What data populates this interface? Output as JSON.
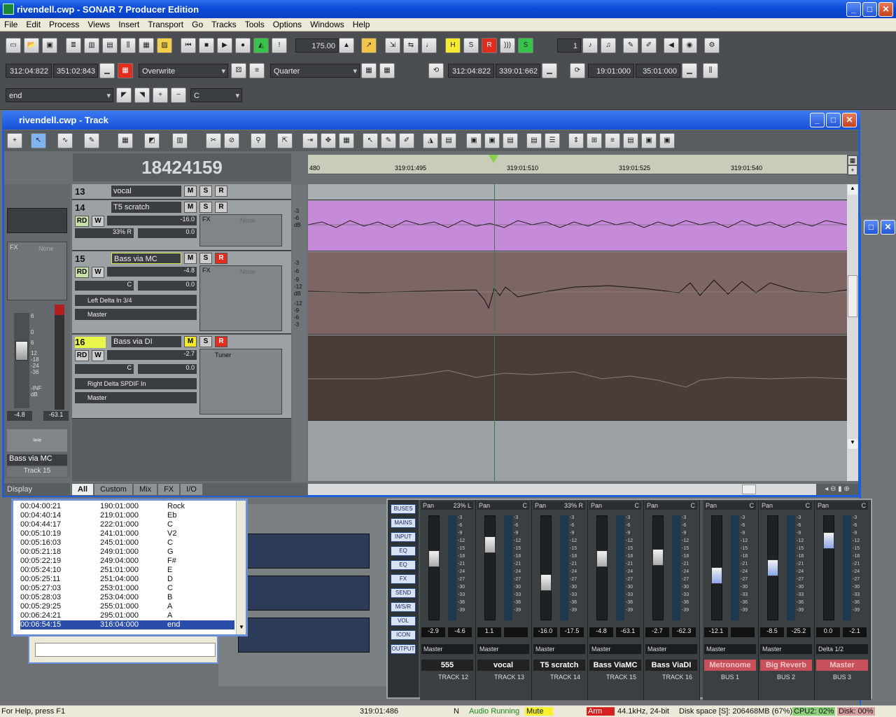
{
  "window": {
    "title": "rivendell.cwp - SONAR 7 Producer Edition"
  },
  "menu": [
    "File",
    "Edit",
    "Process",
    "Views",
    "Insert",
    "Transport",
    "Go",
    "Tracks",
    "Tools",
    "Options",
    "Windows",
    "Help"
  ],
  "toolbar": {
    "tempo": "175.00",
    "now_start": "312:04:822",
    "now_end": "351:02:843",
    "edit_mode": "Overwrite",
    "snap": "Quarter",
    "loop_start": "312:04:822",
    "loop_end": "339:01:662",
    "punch_start": "19:01:000",
    "punch_end": "35:01:000",
    "meter": "1",
    "marker_combo": "end",
    "key_combo": "C",
    "h": "H",
    "s": "S",
    "r": "R"
  },
  "trackview": {
    "title": "rivendell.cwp - Track",
    "counter": "18424159",
    "ruler": [
      "480",
      "319:01:495",
      "319:01:510",
      "319:01:525",
      "319:01:540"
    ],
    "tracks": [
      {
        "num": "13",
        "name": "vocal"
      },
      {
        "num": "14",
        "name": "T5 scratch",
        "vol": "-16.0",
        "pan": "33% R",
        "trim": "0.0",
        "fx": "FX",
        "none": "None"
      },
      {
        "num": "15",
        "name": "Bass via MC",
        "vol": "-4.8",
        "pan": "C",
        "trim": "0.0",
        "input": "Left Delta In 3/4",
        "output": "Master",
        "fx": "FX",
        "none": "None"
      },
      {
        "num": "16",
        "name": "Bass via DI",
        "vol": "-2.7",
        "pan": "C",
        "trim": "0.0",
        "input": "Right Delta SPDIF In",
        "output": "Master",
        "tuner": "Tuner"
      }
    ],
    "msr": {
      "m": "M",
      "s": "S",
      "r": "R",
      "rd": "RD",
      "w": "W"
    },
    "db_labels": [
      "-3",
      "-6",
      "dB",
      "-3",
      "-6",
      "-9",
      "-12",
      "dB",
      "-12",
      "-9",
      "-6",
      "-3"
    ],
    "tabs": [
      "All",
      "Custom",
      "Mix",
      "FX",
      "I/O"
    ]
  },
  "inspector": {
    "fx": "FX",
    "none": "None",
    "scale": [
      "6",
      "0",
      "6",
      "12",
      "-18",
      "-24",
      "-36",
      "-INF",
      "dB"
    ],
    "vol": "-4.8",
    "peak": "-63.1",
    "track_name": "Bass via MC",
    "track_label": "Track 15",
    "display": "Display"
  },
  "markers": [
    {
      "time": "00:04:00:21",
      "mbt": "190:01:000",
      "name": "Rock"
    },
    {
      "time": "00:04:40:14",
      "mbt": "219:01:000",
      "name": "Eb"
    },
    {
      "time": "00:04:44:17",
      "mbt": "222:01:000",
      "name": "C"
    },
    {
      "time": "00:05:10:19",
      "mbt": "241:01:000",
      "name": "V2"
    },
    {
      "time": "00:05:16:03",
      "mbt": "245:01:000",
      "name": "C"
    },
    {
      "time": "00:05:21:18",
      "mbt": "249:01:000",
      "name": "G"
    },
    {
      "time": "00:05:22:19",
      "mbt": "249:04:000",
      "name": "F#"
    },
    {
      "time": "00:05:24:10",
      "mbt": "251:01:000",
      "name": "E"
    },
    {
      "time": "00:05:25:11",
      "mbt": "251:04:000",
      "name": "D"
    },
    {
      "time": "00:05:27:03",
      "mbt": "253:01:000",
      "name": "C"
    },
    {
      "time": "00:05:28:03",
      "mbt": "253:04:000",
      "name": "B"
    },
    {
      "time": "00:05:29:25",
      "mbt": "255:01:000",
      "name": "A"
    },
    {
      "time": "00:06:24:21",
      "mbt": "295:01:000",
      "name": "A"
    },
    {
      "time": "00:06:54:15",
      "mbt": "316:04:000",
      "name": "end"
    }
  ],
  "console": {
    "side_buttons": [
      "BUSES",
      "MAINS",
      "INPUT",
      "EQ PLOT",
      "EQ",
      "FX",
      "SEND",
      "M/S/R",
      "VOL",
      "ICON",
      "OUTPUT"
    ],
    "pan_label": "Pan",
    "output": "Master",
    "strips": [
      {
        "pan": "23% L",
        "vol": "-2.9",
        "peak": "-4.6",
        "name": "555",
        "label": "TRACK 12",
        "out": "Master",
        "level": 0.38,
        "kind": "track"
      },
      {
        "pan": "C",
        "vol": "1.1",
        "peak": "",
        "name": "vocal",
        "label": "TRACK 13",
        "out": "Master",
        "level": 0.22,
        "kind": "track"
      },
      {
        "pan": "33% R",
        "vol": "-16.0",
        "peak": "-17.5",
        "name": "T5 scratch",
        "label": "TRACK 14",
        "out": "Master",
        "level": 0.64,
        "kind": "track"
      },
      {
        "pan": "C",
        "vol": "-4.8",
        "peak": "-63.1",
        "name": "Bass ViaMC",
        "label": "TRACK 15",
        "out": "Master",
        "level": 0.38,
        "kind": "track"
      },
      {
        "pan": "C",
        "vol": "-2.7",
        "peak": "-62.3",
        "name": "Bass ViaDI",
        "label": "TRACK 16",
        "out": "Master",
        "level": 0.36,
        "kind": "track"
      },
      {
        "pan": "C",
        "vol": "-12.1",
        "peak": "",
        "name": "Metronome",
        "label": "BUS 1",
        "out": "Master",
        "level": 0.56,
        "kind": "bus"
      },
      {
        "pan": "C",
        "vol": "-8.5",
        "peak": "-25.2",
        "name": "Big Reverb",
        "label": "BUS 2",
        "out": "Master",
        "level": 0.48,
        "kind": "bus"
      },
      {
        "pan": "C",
        "vol": "0.0",
        "peak": "-2.1",
        "name": "Master",
        "label": "BUS 3",
        "out": "Delta 1/2",
        "level": 0.18,
        "kind": "bus"
      }
    ],
    "meter_scale": [
      "-3",
      "-6",
      "-9",
      "-12",
      "-15",
      "-18",
      "-21",
      "-24",
      "-27",
      "-30",
      "-33",
      "-36",
      "-39"
    ]
  },
  "status": {
    "help": "For Help, press F1",
    "position": "319:01:486",
    "n": "N",
    "audio": "Audio Running",
    "mute": "Mute",
    "arm": "Arm",
    "format": "44.1kHz, 24-bit",
    "disk": "Disk space [S]: 206468MB (67%)",
    "cpu": "CPU2: 02%",
    "diskpct": "Disk: 00%"
  },
  "colors": {
    "title_blue": "#0a4ad6",
    "track14_clip": "#c58ad8",
    "track15_clip": "#7d6563",
    "track16_clip": "#4a3d38",
    "record_red": "#e02d1e",
    "solo_yellow": "#f7ea2c"
  }
}
